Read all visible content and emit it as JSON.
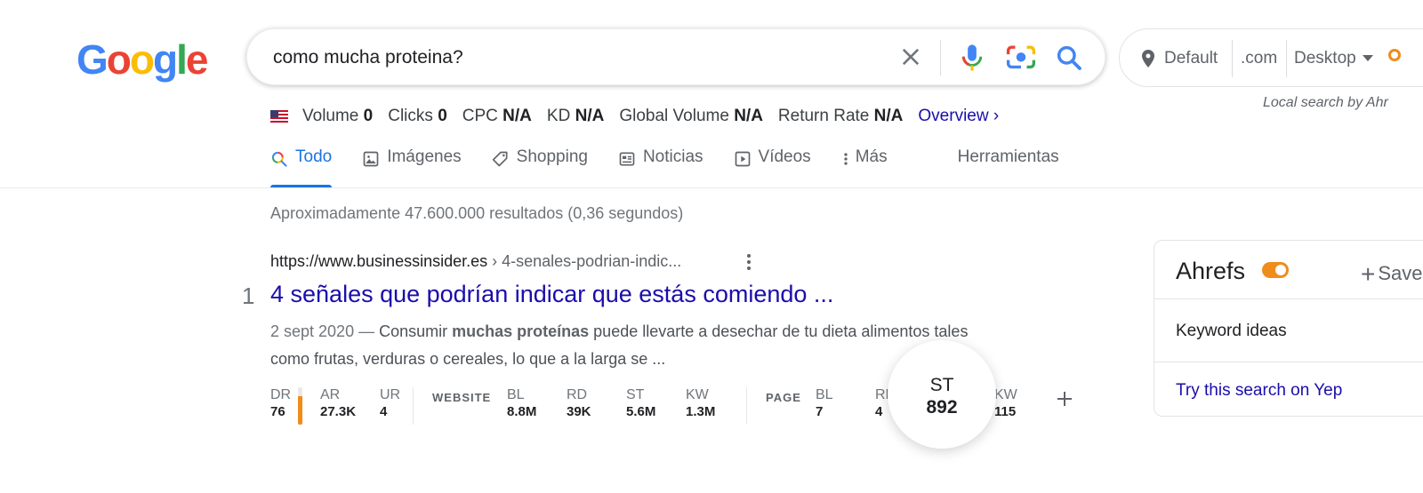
{
  "logo": {
    "letters": [
      "G",
      "o",
      "o",
      "g",
      "l",
      "e"
    ],
    "colors": [
      "#4285F4",
      "#EA4335",
      "#FBBC05",
      "#4285F4",
      "#34A853",
      "#EA4335"
    ]
  },
  "search": {
    "query": "como mucha proteina?"
  },
  "location": {
    "default": "Default",
    "tld": ".com",
    "device": "Desktop",
    "note": "Local search by Ahr"
  },
  "metrics": [
    {
      "label": "Volume",
      "value": "0"
    },
    {
      "label": "Clicks",
      "value": "0"
    },
    {
      "label": "CPC",
      "value": "N/A"
    },
    {
      "label": "KD",
      "value": "N/A"
    },
    {
      "label": "Global Volume",
      "value": "N/A"
    },
    {
      "label": "Return Rate",
      "value": "N/A"
    }
  ],
  "overview_link": "Overview ›",
  "tabs": {
    "todo": "Todo",
    "imagenes": "Imágenes",
    "shopping": "Shopping",
    "noticias": "Noticias",
    "videos": "Vídeos",
    "mas": "Más",
    "herramientas": "Herramientas"
  },
  "stats": "Aproximadamente 47.600.000 resultados (0,36 segundos)",
  "result": {
    "number": "1",
    "url": "https://www.businessinsider.es",
    "path": " › 4-senales-podrian-indic...",
    "title": "4 señales que podrían indicar que estás comiendo ...",
    "date": "2 sept 2020 — ",
    "snippet_pre": "Consumir ",
    "snippet_bold": "muchas proteínas",
    "snippet_post": " puede llevarte a desechar de tu dieta alimentos tales como frutas, verduras o cereales, lo que a la larga se ..."
  },
  "seo": {
    "dr": {
      "k": "DR",
      "v": "76",
      "fill": 0.76
    },
    "ar": {
      "k": "AR",
      "v": "27.3K"
    },
    "ur": {
      "k": "UR",
      "v": "4"
    },
    "website_label": "WEBSITE",
    "w_bl": {
      "k": "BL",
      "v": "8.8M"
    },
    "w_rd": {
      "k": "RD",
      "v": "39K"
    },
    "w_st": {
      "k": "ST",
      "v": "5.6M"
    },
    "w_kw": {
      "k": "KW",
      "v": "1.3M"
    },
    "page_label": "PAGE",
    "p_bl": {
      "k": "BL",
      "v": "7"
    },
    "p_rd": {
      "k": "RD",
      "v": "4"
    },
    "p_kw": {
      "k": "KW",
      "v": "115"
    }
  },
  "bubble": {
    "k": "ST",
    "v": "892"
  },
  "panel": {
    "title": "Ahrefs",
    "save": "Save",
    "keyword_ideas": "Keyword ideas",
    "yep": "Try this search on Yep"
  }
}
